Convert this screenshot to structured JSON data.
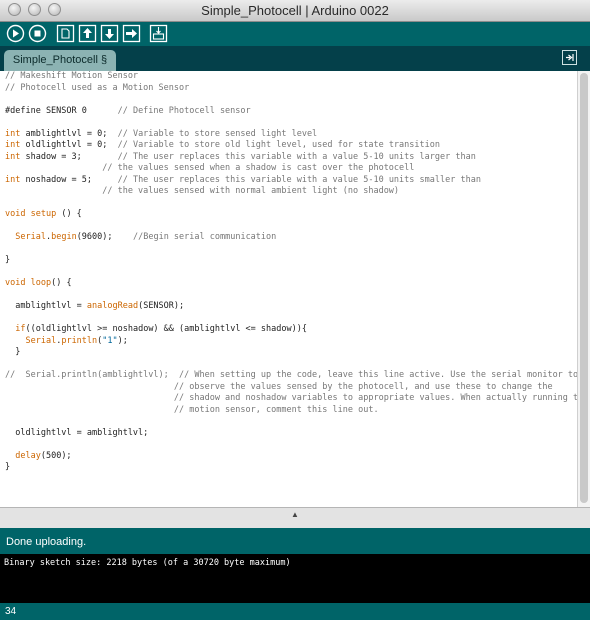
{
  "window": {
    "title": "Simple_Photocell | Arduino 0022"
  },
  "toolbar": {
    "buttons": [
      "verify-icon",
      "stop-icon",
      "new-icon",
      "open-icon",
      "save-icon",
      "upload-icon",
      "serial-monitor-icon"
    ]
  },
  "tabs": {
    "active_label": "Simple_Photocell §"
  },
  "code_lines": [
    [
      {
        "t": "// Makeshift Motion Sensor",
        "c": "c"
      }
    ],
    [
      {
        "t": "// Photocell used as a Motion Sensor",
        "c": "c"
      }
    ],
    [],
    [
      {
        "t": "#define SENSOR 0      "
      },
      {
        "t": "// Define Photocell sensor",
        "c": "c"
      }
    ],
    [],
    [
      {
        "t": "int",
        "c": "k"
      },
      {
        "t": " amblightlvl = 0;  "
      },
      {
        "t": "// Variable to store sensed light level",
        "c": "c"
      }
    ],
    [
      {
        "t": "int",
        "c": "k"
      },
      {
        "t": " oldlightlvl = 0;  "
      },
      {
        "t": "// Variable to store old light level, used for state transition",
        "c": "c"
      }
    ],
    [
      {
        "t": "int",
        "c": "k"
      },
      {
        "t": " shadow = 3;       "
      },
      {
        "t": "// The user replaces this variable with a value 5-10 units larger than",
        "c": "c"
      }
    ],
    [
      {
        "t": "                   "
      },
      {
        "t": "// the values sensed when a shadow is cast over the photocell",
        "c": "c"
      }
    ],
    [
      {
        "t": "int",
        "c": "k"
      },
      {
        "t": " noshadow = 5;     "
      },
      {
        "t": "// The user replaces this variable with a value 5-10 units smaller than",
        "c": "c"
      }
    ],
    [
      {
        "t": "                   "
      },
      {
        "t": "// the values sensed with normal ambient light (no shadow)",
        "c": "c"
      }
    ],
    [],
    [
      {
        "t": "void",
        "c": "k"
      },
      {
        "t": " "
      },
      {
        "t": "setup",
        "c": "k"
      },
      {
        "t": " () {"
      }
    ],
    [],
    [
      {
        "t": "  "
      },
      {
        "t": "Serial",
        "c": "k"
      },
      {
        "t": "."
      },
      {
        "t": "begin",
        "c": "k"
      },
      {
        "t": "(9600);    "
      },
      {
        "t": "//Begin serial communication",
        "c": "c"
      }
    ],
    [],
    [
      {
        "t": "}"
      }
    ],
    [],
    [
      {
        "t": "void",
        "c": "k"
      },
      {
        "t": " "
      },
      {
        "t": "loop",
        "c": "k"
      },
      {
        "t": "() {"
      }
    ],
    [],
    [
      {
        "t": "  amblightlvl = "
      },
      {
        "t": "analogRead",
        "c": "k"
      },
      {
        "t": "(SENSOR);"
      }
    ],
    [],
    [
      {
        "t": "  "
      },
      {
        "t": "if",
        "c": "k"
      },
      {
        "t": "((oldlightlvl >= noshadow) && (amblightlvl <= shadow)){"
      }
    ],
    [
      {
        "t": "    "
      },
      {
        "t": "Serial",
        "c": "k"
      },
      {
        "t": "."
      },
      {
        "t": "println",
        "c": "k"
      },
      {
        "t": "("
      },
      {
        "t": "\"1\"",
        "c": "b"
      },
      {
        "t": ");"
      }
    ],
    [
      {
        "t": "  }"
      }
    ],
    [],
    [
      {
        "t": "//  Serial.println(amblightlvl);  // When setting up the code, leave this line active. Use the serial monitor to",
        "c": "c"
      }
    ],
    [
      {
        "t": "                                 // observe the values sensed by the photocell, and use these to change the",
        "c": "c"
      }
    ],
    [
      {
        "t": "                                 // shadow and noshadow variables to appropriate values. When actually running the",
        "c": "c"
      }
    ],
    [
      {
        "t": "                                 // motion sensor, comment this line out.",
        "c": "c"
      }
    ],
    [],
    [
      {
        "t": "  oldlightlvl = amblightlvl;"
      }
    ],
    [],
    [
      {
        "t": "  "
      },
      {
        "t": "delay",
        "c": "k"
      },
      {
        "t": "(500);"
      }
    ],
    [
      {
        "t": "}"
      }
    ]
  ],
  "status": {
    "message": "Done uploading."
  },
  "console": {
    "line": "Binary sketch size: 2218 bytes (of a 30720 byte maximum)"
  },
  "footer": {
    "line_number": "34"
  },
  "colors": {
    "teal": "#006468",
    "dark_teal": "#04404a",
    "keyword": "#cc6600",
    "string": "#006699",
    "comment": "#777777"
  }
}
